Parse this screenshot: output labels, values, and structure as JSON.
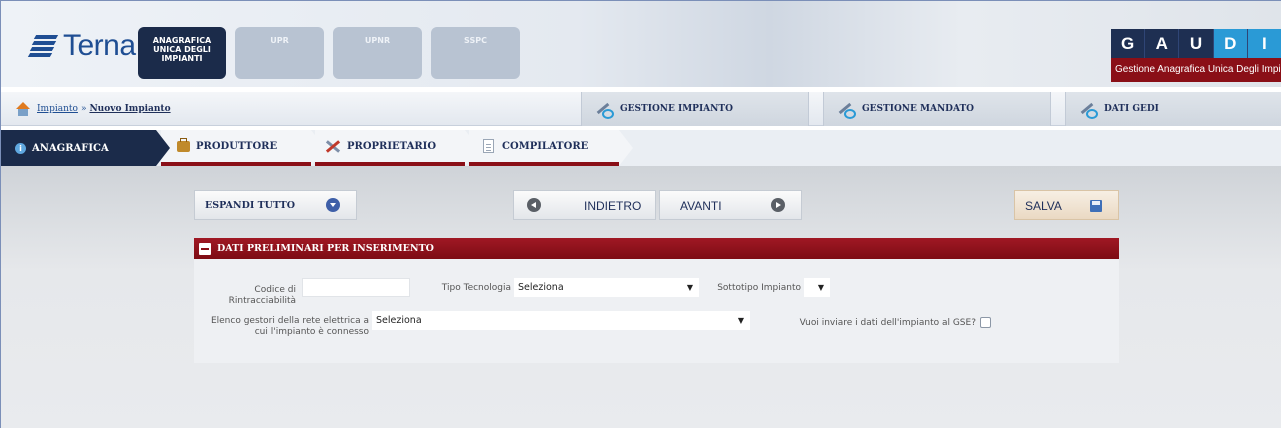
{
  "header": {
    "logo_text": "Terna",
    "modules": [
      {
        "label_lines": [
          "ANAGRAFICA",
          "UNICA DEGLI",
          "IMPIANTI"
        ],
        "active": true
      },
      {
        "label": "UPR",
        "active": false
      },
      {
        "label": "UPNR",
        "active": false
      },
      {
        "label": "SSPC",
        "active": false
      }
    ],
    "gaudi_letters": [
      "G",
      "A",
      "U",
      "D",
      "I"
    ],
    "gaudi_subtitle": "Gestione Anagrafica Unica Degli Impianti"
  },
  "breadcrumb": {
    "root": "Impianto",
    "separator": "»",
    "current": "Nuovo Impianto"
  },
  "top_actions": [
    {
      "label": "GESTIONE IMPIANTO",
      "icon": "tools-icon"
    },
    {
      "label": "GESTIONE MANDATO",
      "icon": "tools-icon"
    },
    {
      "label": "DATI GEDI",
      "icon": "tools-icon"
    }
  ],
  "tabs": [
    {
      "label": "ANAGRAFICA",
      "icon": "info-icon",
      "active": true
    },
    {
      "label": "PRODUTTORE",
      "icon": "briefcase-icon",
      "active": false
    },
    {
      "label": "PROPRIETARIO",
      "icon": "tools-icon",
      "active": false
    },
    {
      "label": "COMPILATORE",
      "icon": "document-icon",
      "active": false
    }
  ],
  "toolbar": {
    "expand_all": "ESPANDI TUTTO",
    "back": "INDIETRO",
    "next": "AVANTI",
    "save": "SALVA"
  },
  "section": {
    "title": "DATI PRELIMINARI PER INSERIMENTO",
    "codice_label_1": "Codice di",
    "codice_label_2": "Rintracciabilità",
    "codice_value": "",
    "tipo_tecnologia_label": "Tipo Tecnologia",
    "tipo_tecnologia_value": "Seleziona",
    "sottotipo_label": "Sottotipo Impianto",
    "sottotipo_value": "",
    "elenco_label_1": "Elenco gestori della rete elettrica a",
    "elenco_label_2": "cui l'impianto è connesso",
    "elenco_value": "Seleziona",
    "gse_label": "Vuoi inviare i dati dell'impianto al GSE?",
    "gse_checked": false
  },
  "colors": {
    "brand_blue": "#1f4e93",
    "dark_navy": "#1b2b4a",
    "section_red": "#8a0f17",
    "gaudi_cyan": "#2a9ad6"
  }
}
